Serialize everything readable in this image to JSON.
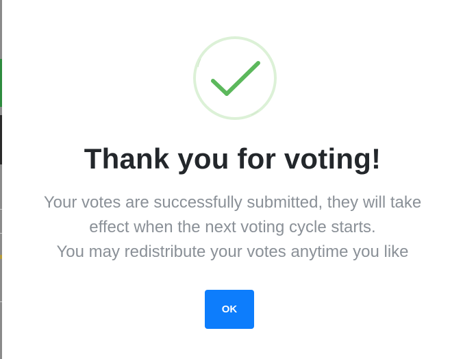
{
  "modal": {
    "title": "Thank you for voting!",
    "message_lines": [
      "Your votes are successfully submitted, they will take",
      "effect when the next voting cycle starts.",
      "You may redistribute your votes anytime you like"
    ],
    "confirm_label": "OK",
    "icon": "success-check-icon"
  },
  "colors": {
    "title": "#23272b",
    "message": "#8a9097",
    "button": "#0d7dfc",
    "check": "#5cb85c",
    "check_ring": "#dcf1d7"
  }
}
